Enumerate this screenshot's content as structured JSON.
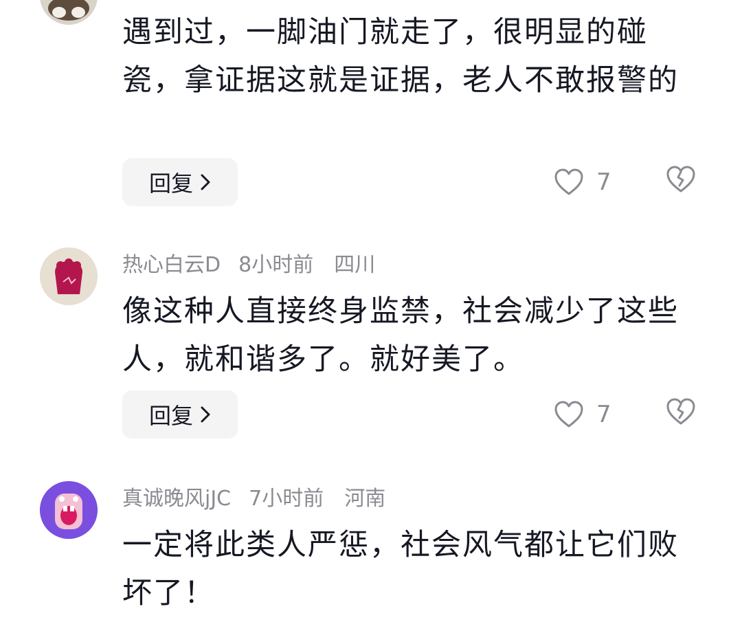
{
  "comments": [
    {
      "username": "",
      "time": "",
      "location": "",
      "text": "遇到过，一脚油门就走了，很明显的碰瓷，拿证据这就是证据，老人不敢报警的",
      "reply_label": "回复",
      "like_count": "7",
      "avatar_color": "#6b5a4a"
    },
    {
      "username": "热心白云D",
      "time": "8小时前",
      "location": "四川",
      "text": "像这种人直接终身监禁，社会减少了这些人，就和谐多了。就好美了。",
      "reply_label": "回复",
      "like_count": "7",
      "avatar_color": "#c2185b"
    },
    {
      "username": "真诚晚风jJC",
      "time": "7小时前",
      "location": "河南",
      "text": "一定将此类人严惩，社会风气都让它们败坏了！",
      "reply_label": "",
      "like_count": "",
      "avatar_color": "#7c4dff"
    }
  ],
  "icons": {
    "chevron": "chevron-right-icon",
    "like": "heart-outline-icon",
    "dislike": "broken-heart-icon"
  },
  "colors": {
    "meta_text": "#8a8b91",
    "body_text": "#161823",
    "reply_bg": "#f4f4f5"
  }
}
